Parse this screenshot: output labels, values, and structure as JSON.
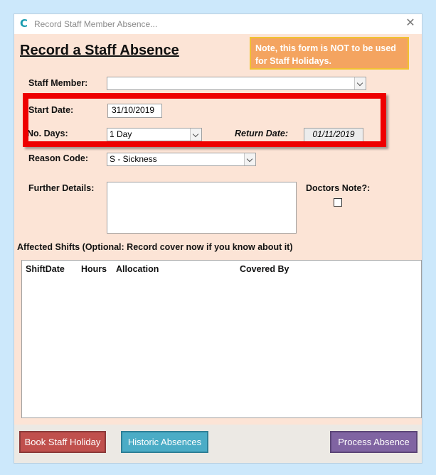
{
  "window": {
    "title": "Record Staff Member Absence...",
    "close_glyph": "✕"
  },
  "form": {
    "heading": "Record a Staff Absence",
    "note": "Note, this form is NOT to be used for Staff Holidays.",
    "staff_member_label": "Staff Member:",
    "staff_member_value": "",
    "start_date_label": "Start Date:",
    "start_date_value": "31/10/2019",
    "no_days_label": "No. Days:",
    "no_days_value": "1 Day",
    "return_date_label": "Return Date:",
    "return_date_value": "01/11/2019",
    "reason_code_label": "Reason Code:",
    "reason_code_value": "S - Sickness",
    "further_details_label": "Further Details:",
    "further_details_value": "",
    "doctors_note_label": "Doctors Note?:",
    "doctors_note_checked": false
  },
  "shifts": {
    "section_label": "Affected Shifts (Optional: Record cover now if you know about it)",
    "columns": [
      "ShiftDate",
      "Hours",
      "Allocation",
      "Covered By"
    ],
    "rows": []
  },
  "footer": {
    "book_holiday": "Book Staff Holiday",
    "historic": "Historic Absences",
    "process": "Process Absence"
  },
  "colors": {
    "form_bg": "#fce4d6",
    "note_bg": "#f4a460",
    "highlight_box": "#ee0000",
    "btn_red": "#c0504d",
    "btn_teal": "#4bacc6",
    "btn_purple": "#8064a2"
  }
}
